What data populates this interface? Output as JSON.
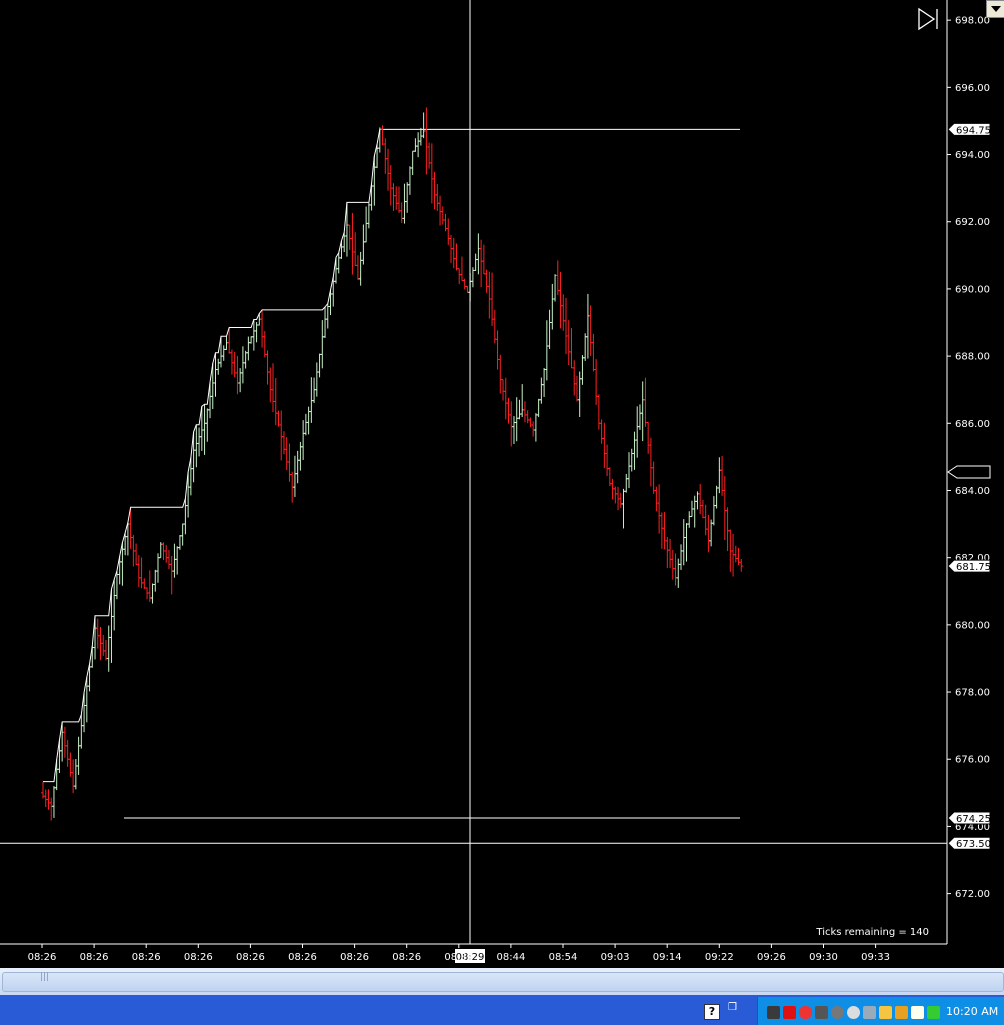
{
  "chart_data": {
    "type": "bar",
    "subtype": "ohlc-price-bars",
    "ylim": [
      670.5,
      698.6
    ],
    "y_ticks": [
      "672.00",
      "674.00",
      "676.00",
      "678.00",
      "680.00",
      "682.00",
      "684.00",
      "686.00",
      "688.00",
      "690.00",
      "692.00",
      "694.00",
      "696.00",
      "698.00"
    ],
    "y_tick_values": [
      672,
      674,
      676,
      678,
      680,
      682,
      684,
      686,
      688,
      690,
      692,
      694,
      696,
      698
    ],
    "x_labels": [
      "08:26",
      "08:26",
      "08:26",
      "08:26",
      "08:26",
      "08:26",
      "08:26",
      "08:26",
      "08:36",
      "08:44",
      "08:54",
      "09:03",
      "09:14",
      "09:22",
      "09:26",
      "09:30",
      "09:33"
    ],
    "crosshair_time_label": "08:29",
    "price_markers": [
      {
        "label": "694.75",
        "value": 694.75
      },
      {
        "label": "681.75",
        "value": 681.75
      },
      {
        "label": "674.25",
        "value": 674.25
      },
      {
        "label": "673.50",
        "value": 673.5
      }
    ],
    "high_line_value": 694.75,
    "low_line_value": 674.25,
    "crosshair_price": 673.5,
    "ticks_remaining_label": "Ticks remaining = 140",
    "path": [
      675.0,
      674.6,
      676.8,
      675.2,
      677.6,
      679.9,
      679.0,
      681.5,
      683.0,
      681.4,
      680.8,
      682.4,
      681.6,
      683.0,
      685.2,
      686.0,
      687.6,
      688.4,
      687.2,
      688.4,
      689.1,
      687.0,
      685.6,
      684.1,
      685.7,
      687.0,
      689.1,
      690.6,
      691.9,
      690.3,
      692.5,
      694.75,
      693.0,
      692.1,
      694.1,
      694.7,
      692.8,
      691.8,
      690.6,
      689.9,
      691.2,
      689.7,
      687.3,
      685.9,
      686.4,
      685.8,
      687.6,
      690.4,
      688.6,
      686.7,
      689.2,
      686.0,
      684.2,
      683.6,
      685.1,
      686.7,
      684.0,
      682.5,
      681.4,
      683.0,
      683.9,
      682.5,
      684.6,
      682.2,
      681.75
    ],
    "colors": {
      "background": "#000000",
      "up": "#c9f2c9",
      "down": "#ff2020",
      "line": "#ffffff",
      "step": "#ffffff"
    }
  },
  "taskbar": {
    "clock": "10:20 AM",
    "help": "?"
  },
  "scrollbar": {
    "grip": "|||"
  }
}
